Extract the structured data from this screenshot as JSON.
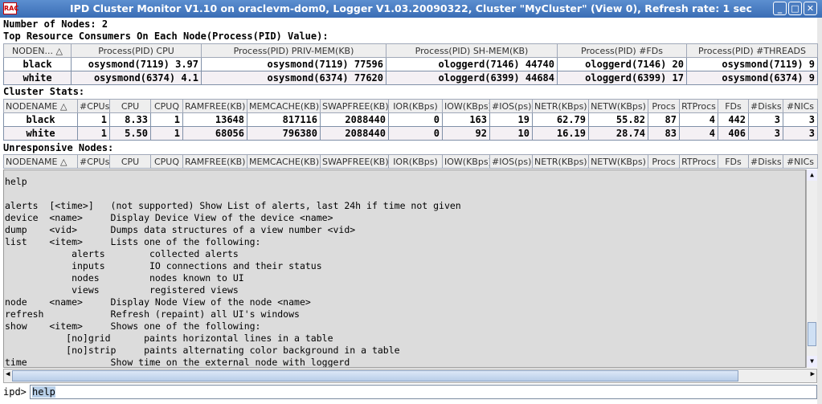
{
  "window": {
    "title": "IPD Cluster Monitor V1.10 on oraclevm-dom0, Logger V1.03.20090322, Cluster \"MyCluster\"  (View 0), Refresh rate: 1 sec",
    "icon_text": "RAC"
  },
  "labels": {
    "nodes": "Number of Nodes: 2",
    "top": "Top Resource Consumers On Each Node(Process(PID) Value):",
    "cluster": "Cluster Stats:",
    "unresponsive": "Unresponsive Nodes:"
  },
  "top_table": {
    "headers": [
      "NODEN... △",
      "Process(PID) CPU",
      "Process(PID) PRIV-MEM(KB)",
      "Process(PID) SH-MEM(KB)",
      "Process(PID) #FDs",
      "Process(PID) #THREADS"
    ],
    "rows": [
      [
        "black",
        "osysmond(7119) 3.97",
        "osysmond(7119) 77596",
        "ologgerd(7146) 44740",
        "ologgerd(7146) 20",
        "osysmond(7119) 9"
      ],
      [
        "white",
        "osysmond(6374) 4.1",
        "osysmond(6374) 77620",
        "ologgerd(6399) 44684",
        "ologgerd(6399) 17",
        "osysmond(6374) 9"
      ]
    ]
  },
  "stats_headers": [
    "NODENAME △",
    "#CPUs",
    "CPU",
    "CPUQ",
    "RAMFREE(KB)",
    "MEMCACHE(KB)",
    "SWAPFREE(KB)",
    "IOR(KBps)",
    "IOW(KBps)",
    "#IOS(ps)",
    "NETR(KBps)",
    "NETW(KBps)",
    "Procs",
    "RTProcs",
    "FDs",
    "#Disks",
    "#NICs"
  ],
  "stats_rows": [
    [
      "black",
      "1",
      "8.33",
      "1",
      "13648",
      "817116",
      "2088440",
      "0",
      "163",
      "19",
      "62.79",
      "55.82",
      "87",
      "4",
      "442",
      "3",
      "3"
    ],
    [
      "white",
      "1",
      "5.50",
      "1",
      "68056",
      "796380",
      "2088440",
      "0",
      "92",
      "10",
      "16.19",
      "28.74",
      "83",
      "4",
      "406",
      "3",
      "3"
    ]
  ],
  "console_lines": [
    "  ─        ────────────── ───────── ───────────",
    "help",
    "",
    "alerts  [<time>]   (not supported) Show List of alerts, last 24h if time not given",
    "device  <name>     Display Device View of the device <name>",
    "dump    <vid>      Dumps data structures of a view number <vid>",
    "list    <item>     Lists one of the following:",
    "            alerts        collected alerts",
    "            inputs        IO connections and their status",
    "            nodes         nodes known to UI",
    "            views         registered views",
    "node    <name>     Display Node View of the node <name>",
    "refresh            Refresh (repaint) all UI's windows",
    "show    <item>     Shows one of the following:",
    "           [no]grid      paints horizontal lines in a table",
    "           [no]strip     paints alternating color background in a table",
    "time               Show time on the external node with loggerd"
  ],
  "prompt": "ipd>",
  "input_value": "help"
}
